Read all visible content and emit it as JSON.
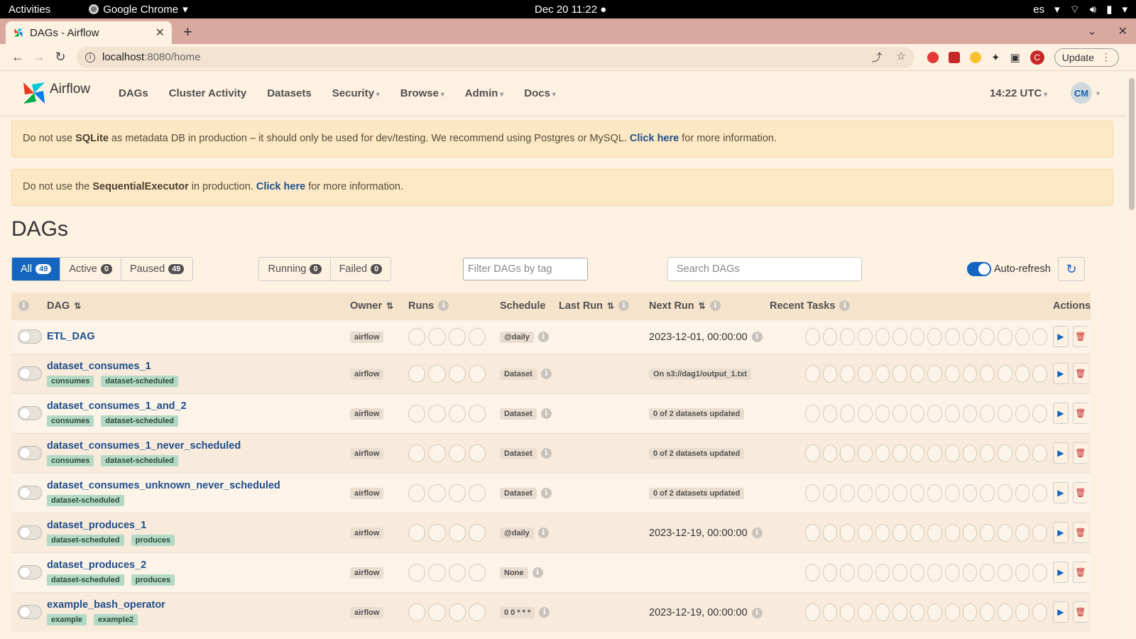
{
  "os": {
    "activities": "Activities",
    "app_name": "Google Chrome",
    "clock": "Dec 20  11:22",
    "lang": "es"
  },
  "browser": {
    "tab_title": "DAGs - Airflow",
    "url_host": "localhost",
    "url_path": ":8080/home",
    "update_label": "Update",
    "profile_initial": "C"
  },
  "nav": {
    "brand": "Airflow",
    "items": [
      "DAGs",
      "Cluster Activity",
      "Datasets",
      "Security",
      "Browse",
      "Admin",
      "Docs"
    ],
    "time": "14:22 UTC",
    "user_initials": "CM"
  },
  "alerts": {
    "a1_pre": "Do not use ",
    "a1_bold": "SQLite",
    "a1_mid": " as metadata DB in production – it should only be used for dev/testing. We recommend using Postgres or MySQL. ",
    "a1_link": "Click here",
    "a1_post": " for more information.",
    "a2_pre": "Do not use the ",
    "a2_bold": "SequentialExecutor",
    "a2_mid": " in production. ",
    "a2_link": "Click here",
    "a2_post": " for more information."
  },
  "page": {
    "title": "DAGs"
  },
  "filters": {
    "all_label": "All",
    "all_count": "49",
    "active_label": "Active",
    "active_count": "0",
    "paused_label": "Paused",
    "paused_count": "49",
    "running_label": "Running",
    "running_count": "0",
    "failed_label": "Failed",
    "failed_count": "0",
    "tag_placeholder": "Filter DAGs by tag",
    "search_placeholder": "Search DAGs",
    "autorefresh_label": "Auto-refresh"
  },
  "table": {
    "headers": {
      "dag": "DAG",
      "owner": "Owner",
      "runs": "Runs",
      "schedule": "Schedule",
      "last_run": "Last Run",
      "next_run": "Next Run",
      "recent_tasks": "Recent Tasks",
      "actions": "Actions"
    },
    "rows": [
      {
        "name": "ETL_DAG",
        "tags": [],
        "owner": "airflow",
        "schedule": "@daily",
        "next_run": "2023-12-01, 00:00:00",
        "next_run_pill": ""
      },
      {
        "name": "dataset_consumes_1",
        "tags": [
          "consumes",
          "dataset-scheduled"
        ],
        "owner": "airflow",
        "schedule": "Dataset",
        "next_run": "",
        "next_run_pill": "On s3://dag1/output_1.txt"
      },
      {
        "name": "dataset_consumes_1_and_2",
        "tags": [
          "consumes",
          "dataset-scheduled"
        ],
        "owner": "airflow",
        "schedule": "Dataset",
        "next_run": "",
        "next_run_pill": "0 of 2 datasets updated"
      },
      {
        "name": "dataset_consumes_1_never_scheduled",
        "tags": [
          "consumes",
          "dataset-scheduled"
        ],
        "owner": "airflow",
        "schedule": "Dataset",
        "next_run": "",
        "next_run_pill": "0 of 2 datasets updated"
      },
      {
        "name": "dataset_consumes_unknown_never_scheduled",
        "tags": [
          "dataset-scheduled"
        ],
        "owner": "airflow",
        "schedule": "Dataset",
        "next_run": "",
        "next_run_pill": "0 of 2 datasets updated"
      },
      {
        "name": "dataset_produces_1",
        "tags": [
          "dataset-scheduled",
          "produces"
        ],
        "owner": "airflow",
        "schedule": "@daily",
        "next_run": "2023-12-19, 00:00:00",
        "next_run_pill": ""
      },
      {
        "name": "dataset_produces_2",
        "tags": [
          "dataset-scheduled",
          "produces"
        ],
        "owner": "airflow",
        "schedule": "None",
        "next_run": "",
        "next_run_pill": ""
      },
      {
        "name": "example_bash_operator",
        "tags": [
          "example",
          "example2"
        ],
        "owner": "airflow",
        "schedule": "0 0 * * *",
        "next_run": "2023-12-19, 00:00:00",
        "next_run_pill": ""
      }
    ]
  },
  "colors": {
    "brand_blue": "#1565c0",
    "alert_bg": "#fce8c5",
    "tag_green": "#b5d9c7",
    "page_bg": "#fdf1e2"
  }
}
